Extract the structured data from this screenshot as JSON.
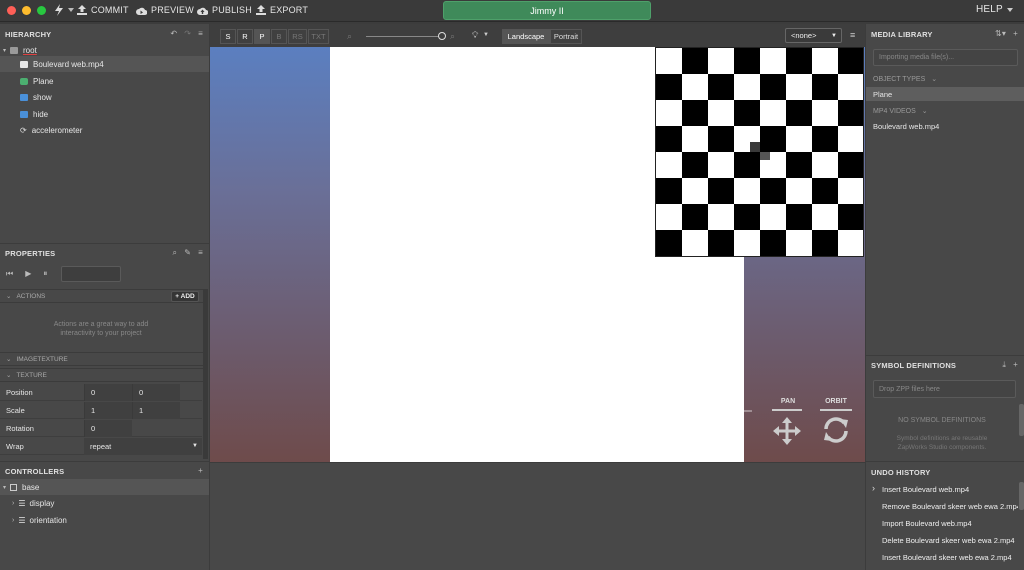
{
  "topbar": {
    "commit": "COMMIT",
    "preview": "PREVIEW",
    "publish": "PUBLISH",
    "export": "EXPORT",
    "project_name": "Jimmy II",
    "help": "HELP"
  },
  "hierarchy": {
    "title": "HIERARCHY",
    "items": [
      {
        "label": "root",
        "icon": "folder-icon"
      },
      {
        "label": "Boulevard web.mp4",
        "icon": "video-icon"
      },
      {
        "label": "Plane",
        "icon": "cube-icon"
      },
      {
        "label": "show",
        "icon": "state-icon"
      },
      {
        "label": "hide",
        "icon": "state-icon"
      },
      {
        "label": "accelerometer",
        "icon": "refresh-icon"
      }
    ]
  },
  "properties": {
    "title": "PROPERTIES",
    "actions_section": "ACTIONS",
    "add_label": "+ ADD",
    "actions_hint_line1": "Actions are a great way to add",
    "actions_hint_line2": "interactivity to your project",
    "imagetexture_section": "IMAGETEXTURE",
    "texture_section": "TEXTURE",
    "rows": [
      {
        "label": "Position",
        "v1": "0",
        "v2": "0"
      },
      {
        "label": "Scale",
        "v1": "1",
        "v2": "1"
      },
      {
        "label": "Rotation",
        "v1": "0",
        "v2": ""
      }
    ],
    "wrap_label": "Wrap",
    "wrap_value": "repeat"
  },
  "controllers": {
    "title": "CONTROLLERS",
    "items": [
      {
        "label": "base"
      },
      {
        "label": "display"
      },
      {
        "label": "orientation"
      }
    ]
  },
  "viewport": {
    "modes": [
      "S",
      "R",
      "P",
      "B",
      "RS",
      "TXT"
    ],
    "landscape": "Landscape",
    "portrait": "Portrait",
    "camera_select": "<none>",
    "zoom_level": 1.0,
    "pan_label": "PAN",
    "orbit_label": "ORBIT"
  },
  "media_library": {
    "title": "MEDIA LIBRARY",
    "importing_placeholder": "Importing media file(s)...",
    "object_types_section": "OBJECT TYPES",
    "object_types": [
      "Plane"
    ],
    "mp4_section": "MP4 VIDEOS",
    "mp4_videos": [
      "Boulevard web.mp4"
    ]
  },
  "symbol_definitions": {
    "title": "SYMBOL DEFINITIONS",
    "drop_placeholder": "Drop ZPP files here",
    "empty_title": "NO SYMBOL DEFINITIONS",
    "empty_line1": "Symbol definitions are reusable",
    "empty_line2": "ZapWorks Studio components."
  },
  "undo_history": {
    "title": "UNDO HISTORY",
    "items": [
      "Insert Boulevard web.mp4",
      "Remove Boulevard skeer web ewa 2.mp4",
      "Import Boulevard web.mp4",
      "Delete Boulevard skeer web ewa 2.mp4",
      "Insert Boulevard skeer web ewa 2.mp4"
    ]
  },
  "colors": {
    "project_green": "#3f8a5a",
    "selection": "#5a5a5a",
    "viewport_sky": "#5b7fc0",
    "viewport_ground": "#6e4b4b"
  }
}
